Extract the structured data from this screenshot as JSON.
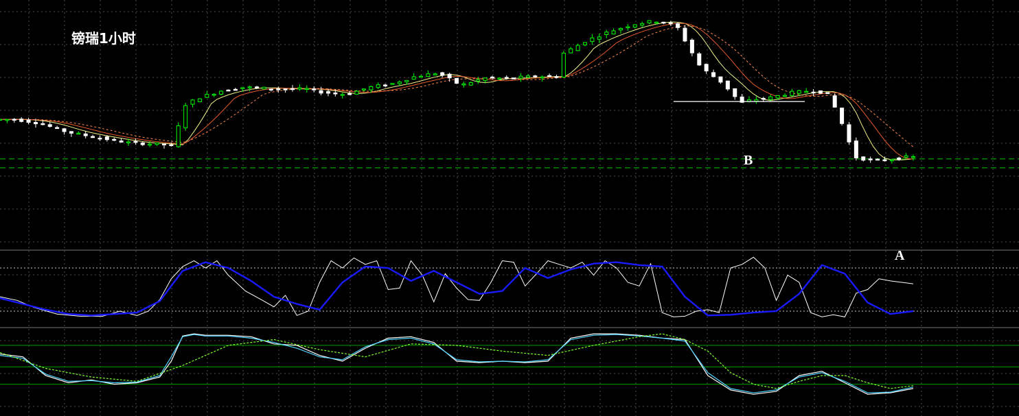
{
  "title": "镑瑞1小时",
  "annotations": {
    "a": "A",
    "b": "B"
  },
  "colors": {
    "background": "#000000",
    "grid": "#4d4d4d",
    "bull_candle": "#00ff00",
    "bear_candle": "#ffffff",
    "ma_fast": "#f4f48a",
    "ma_mid": "#e85a2a",
    "ma_slow": "#ff8a50",
    "sto_main": "#ffffff",
    "sto_signal": "#1a1aff",
    "osc_white": "#ffffff",
    "osc_cyan": "#4fd2ff",
    "osc_pink": "#ff7fd4",
    "osc_green": "#7fff2a",
    "osc_yellow": "#ffff4f",
    "support_line": "#ffffff",
    "level_line": "#00cc00"
  },
  "chart_data": [
    {
      "type": "candlestick",
      "title": "镑瑞1小时",
      "grid": true,
      "ylim": [
        0,
        100
      ],
      "x_range": [
        0,
        160
      ],
      "price_path": [
        [
          0,
          71
        ],
        [
          4,
          71
        ],
        [
          8,
          69
        ],
        [
          13,
          64
        ],
        [
          18,
          61
        ],
        [
          24,
          58
        ],
        [
          30,
          57
        ],
        [
          32,
          56
        ],
        [
          33,
          78
        ],
        [
          36,
          83
        ],
        [
          40,
          87
        ],
        [
          44,
          89
        ],
        [
          50,
          88
        ],
        [
          55,
          88
        ],
        [
          58,
          86
        ],
        [
          62,
          85
        ],
        [
          66,
          89
        ],
        [
          70,
          91
        ],
        [
          74,
          95
        ],
        [
          78,
          97
        ],
        [
          82,
          90
        ],
        [
          86,
          94
        ],
        [
          90,
          94
        ],
        [
          95,
          95
        ],
        [
          99,
          95
        ],
        [
          100,
          108
        ],
        [
          104,
          115
        ],
        [
          108,
          120
        ],
        [
          112,
          124
        ],
        [
          116,
          126
        ],
        [
          118,
          125
        ],
        [
          120,
          122
        ],
        [
          124,
          100
        ],
        [
          128,
          91
        ],
        [
          131,
          80
        ],
        [
          133,
          82
        ],
        [
          136,
          83
        ],
        [
          140,
          86
        ],
        [
          143,
          87
        ],
        [
          146,
          86
        ],
        [
          148,
          75
        ],
        [
          151,
          50
        ],
        [
          154,
          48
        ],
        [
          158,
          49
        ],
        [
          160,
          50
        ]
      ],
      "support_line": {
        "x": [
          118,
          141
        ],
        "y": 81
      },
      "levels": [
        49,
        44
      ],
      "annotations": [
        {
          "text": "A",
          "x": 157,
          "y": 34
        },
        {
          "text": "B",
          "x": 131,
          "y": 72
        }
      ]
    },
    {
      "type": "line",
      "name": "stochastic",
      "grid": true,
      "ylim": [
        0,
        100
      ],
      "levels": [
        80,
        20
      ],
      "series": [
        {
          "role": "main",
          "x": [
            0,
            3,
            6,
            10,
            14,
            18,
            21,
            24,
            26,
            28,
            30,
            32,
            34,
            36,
            38,
            40,
            43,
            46,
            48,
            50,
            52,
            54,
            56,
            58,
            60,
            62,
            64,
            66,
            68,
            70,
            72,
            74,
            76,
            78,
            80,
            82,
            84,
            86,
            88,
            90,
            92,
            94,
            96,
            98,
            100,
            102,
            104,
            106,
            108,
            110,
            112,
            114,
            116,
            118,
            120,
            122,
            124,
            126,
            128,
            130,
            132,
            134,
            136,
            138,
            140,
            142,
            144,
            146,
            148,
            150,
            152,
            154,
            156,
            158,
            160
          ],
          "y": [
            40,
            35,
            25,
            16,
            13,
            13,
            20,
            14,
            20,
            36,
            65,
            82,
            90,
            80,
            90,
            70,
            48,
            35,
            26,
            42,
            14,
            20,
            60,
            90,
            80,
            94,
            85,
            90,
            50,
            52,
            90,
            70,
            33,
            72,
            52,
            36,
            35,
            60,
            90,
            88,
            55,
            72,
            90,
            85,
            80,
            88,
            70,
            90,
            80,
            60,
            55,
            86,
            18,
            12,
            13,
            20,
            22,
            18,
            80,
            85,
            95,
            80,
            35,
            70,
            60,
            18,
            12,
            15,
            12,
            45,
            50,
            65,
            62,
            60,
            58
          ],
          "values_note": ""
        },
        {
          "role": "signal",
          "x": [
            0,
            4,
            8,
            12,
            16,
            20,
            24,
            28,
            32,
            36,
            40,
            44,
            48,
            52,
            56,
            60,
            64,
            68,
            72,
            76,
            80,
            84,
            88,
            92,
            96,
            100,
            104,
            108,
            112,
            116,
            120,
            124,
            128,
            132,
            136,
            140,
            144,
            148,
            152,
            156,
            160
          ],
          "y": [
            38,
            30,
            22,
            16,
            14,
            16,
            18,
            34,
            76,
            88,
            80,
            62,
            40,
            30,
            22,
            60,
            82,
            80,
            62,
            76,
            60,
            44,
            48,
            80,
            66,
            78,
            86,
            88,
            84,
            82,
            40,
            14,
            15,
            18,
            20,
            44,
            84,
            72,
            32,
            16,
            20
          ]
        }
      ]
    },
    {
      "type": "line",
      "name": "oscillator",
      "grid": true,
      "ylim": [
        0,
        100
      ],
      "levels": [
        82,
        52,
        28
      ],
      "series": [
        {
          "color_key": "osc_white",
          "x": [
            0,
            4,
            8,
            12,
            16,
            20,
            24,
            28,
            30,
            32,
            34,
            36,
            40,
            44,
            48,
            52,
            56,
            60,
            64,
            68,
            72,
            76,
            80,
            84,
            88,
            92,
            96,
            100,
            104,
            108,
            112,
            116,
            120,
            124,
            128,
            132,
            136,
            140,
            144,
            148,
            152,
            156,
            160
          ],
          "y": [
            70,
            66,
            40,
            30,
            34,
            28,
            30,
            38,
            60,
            95,
            98,
            96,
            96,
            94,
            84,
            82,
            68,
            60,
            78,
            92,
            94,
            86,
            60,
            58,
            60,
            58,
            60,
            92,
            98,
            98,
            96,
            92,
            90,
            40,
            20,
            14,
            18,
            40,
            46,
            30,
            14,
            16,
            22
          ]
        },
        {
          "color_key": "osc_cyan",
          "x": [
            0,
            4,
            8,
            12,
            16,
            20,
            24,
            28,
            30,
            32,
            34,
            36,
            40,
            44,
            48,
            52,
            56,
            60,
            64,
            68,
            72,
            76,
            80,
            84,
            88,
            92,
            96,
            100,
            104,
            108,
            112,
            116,
            120,
            124,
            128,
            132,
            136,
            140,
            144,
            148,
            152,
            156,
            160
          ],
          "y": [
            68,
            64,
            42,
            32,
            33,
            30,
            31,
            40,
            66,
            94,
            97,
            95,
            95,
            92,
            86,
            78,
            66,
            62,
            80,
            90,
            92,
            84,
            62,
            59,
            60,
            59,
            62,
            90,
            96,
            97,
            95,
            92,
            88,
            44,
            22,
            16,
            20,
            38,
            44,
            32,
            16,
            17,
            24
          ]
        },
        {
          "color_key": "osc_green",
          "x": [
            0,
            8,
            16,
            24,
            32,
            40,
            48,
            56,
            64,
            72,
            80,
            88,
            96,
            104,
            112,
            116,
            120,
            124,
            128,
            132,
            136,
            140,
            144,
            148,
            152,
            156,
            160
          ],
          "y": [
            72,
            50,
            38,
            32,
            54,
            82,
            90,
            76,
            66,
            84,
            82,
            74,
            68,
            82,
            94,
            98,
            90,
            74,
            44,
            28,
            22,
            32,
            40,
            40,
            30,
            22,
            26
          ]
        }
      ]
    }
  ]
}
